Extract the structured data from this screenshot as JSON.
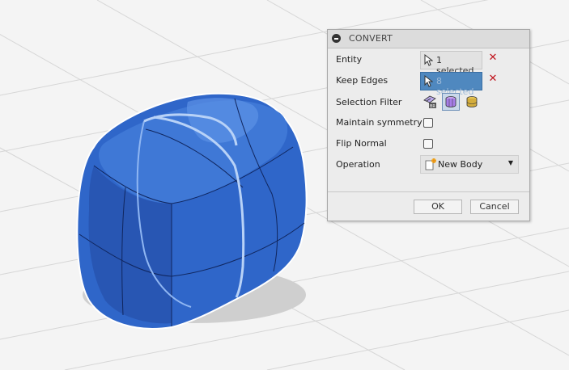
{
  "viewport": {
    "model_color": "#2f66c9",
    "grid_color": "#d6d6d6"
  },
  "dialog": {
    "title": "CONVERT",
    "entity": {
      "label": "Entity",
      "value": "1 selected"
    },
    "keep_edges": {
      "label": "Keep Edges",
      "value": "8 selected"
    },
    "selection_filter": {
      "label": "Selection Filter",
      "icons": [
        "t-spline-body-filter-icon",
        "solid-face-filter-icon",
        "body-filter-icon"
      ]
    },
    "maintain_symmetry": {
      "label": "Maintain symmetry",
      "checked": false
    },
    "flip_normal": {
      "label": "Flip Normal",
      "checked": false
    },
    "operation": {
      "label": "Operation",
      "value": "New Body"
    },
    "ok_label": "OK",
    "cancel_label": "Cancel",
    "accent_color": "#4f88bf",
    "clear_color": "#c0141d"
  }
}
